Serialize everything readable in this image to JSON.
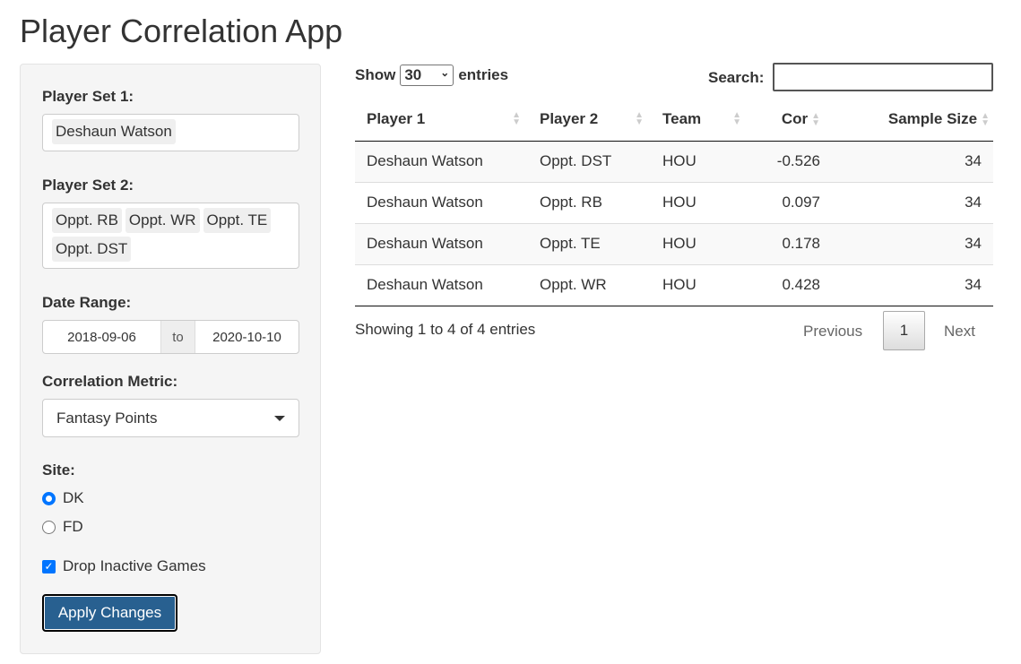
{
  "title": "Player Correlation App",
  "sidebar": {
    "player_set_1": {
      "label": "Player Set 1:",
      "selected": [
        "Deshaun Watson"
      ]
    },
    "player_set_2": {
      "label": "Player Set 2:",
      "selected": [
        "Oppt. RB",
        "Oppt. WR",
        "Oppt. TE",
        "Oppt. DST"
      ]
    },
    "date_range": {
      "label": "Date Range:",
      "start": "2018-09-06",
      "sep": "to",
      "end": "2020-10-10"
    },
    "metric": {
      "label": "Correlation Metric:",
      "value": "Fantasy Points"
    },
    "site": {
      "label": "Site:",
      "options": [
        "DK",
        "FD"
      ],
      "selected": "DK"
    },
    "drop_inactive": {
      "label": "Drop Inactive Games",
      "checked": true
    },
    "apply_label": "Apply Changes"
  },
  "table": {
    "show_label": "Show",
    "entries_value": "30",
    "entries_label": "entries",
    "search_label": "Search:",
    "search_value": "",
    "columns": [
      "Player 1",
      "Player 2",
      "Team",
      "Cor",
      "Sample Size"
    ],
    "rows": [
      [
        "Deshaun Watson",
        "Oppt. DST",
        "HOU",
        "-0.526",
        "34"
      ],
      [
        "Deshaun Watson",
        "Oppt. RB",
        "HOU",
        "0.097",
        "34"
      ],
      [
        "Deshaun Watson",
        "Oppt. TE",
        "HOU",
        "0.178",
        "34"
      ],
      [
        "Deshaun Watson",
        "Oppt. WR",
        "HOU",
        "0.428",
        "34"
      ]
    ],
    "info": "Showing 1 to 4 of 4 entries",
    "pagination": {
      "previous": "Previous",
      "current": "1",
      "next": "Next"
    }
  }
}
